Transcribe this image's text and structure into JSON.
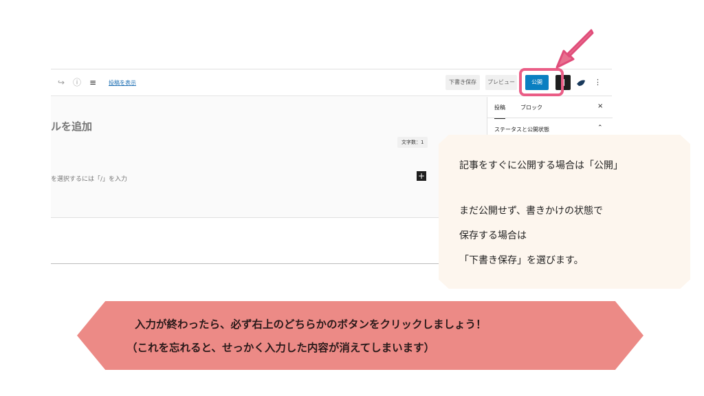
{
  "toolbar": {
    "redo_icon": "↪",
    "info_icon": "ⓘ",
    "list_view_icon": "≡",
    "view_post_label": "投稿を表示",
    "draft_label": "下書き保存",
    "preview_label": "プレビュー",
    "publish_label": "公開",
    "more_icon": "⋮"
  },
  "editor": {
    "title_placeholder": "ルを追加",
    "char_count": "文字数：1",
    "block_placeholder": "を選択するには「/」を入力",
    "add_block_icon": "+"
  },
  "sidebar": {
    "tab_post": "投稿",
    "tab_block": "ブロック",
    "close_icon": "×",
    "section_status": "ステータスと公開状態",
    "chevron_icon": "⌃"
  },
  "callout": {
    "line1": "記事をすぐに公開する場合は「公開」",
    "line2": "まだ公開せず、書きかけの状態で",
    "line3": "保存する場合は",
    "line4": "「下書き保存」を選びます。"
  },
  "banner": {
    "line1": "入力が終わったら、必ず右上のどちらかのボタンをクリックしましょう！",
    "line2": "（これを忘れると、せっかく入力した内容が消えてしまいます）"
  },
  "colors": {
    "publish": "#0a7fc1",
    "highlight": "#ea5d86",
    "banner": "#ec8a86",
    "callout": "#fdf6ee"
  }
}
